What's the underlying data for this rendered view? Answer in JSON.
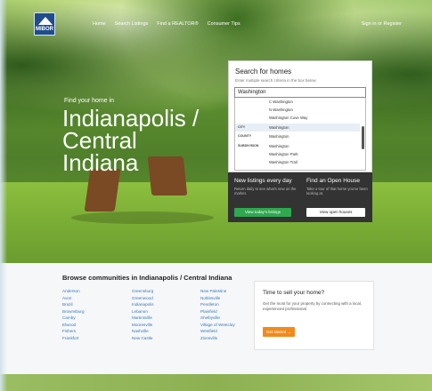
{
  "nav": {
    "logo_text": "MIBOR",
    "items": [
      "Home",
      "Search Listings",
      "Find a REALTOR®",
      "Consumer Tips"
    ],
    "signin": "Sign in or Register"
  },
  "hero": {
    "find_label": "Find your home in",
    "city_line1": "Indianapolis /",
    "city_line2": "Central",
    "city_line3": "Indiana"
  },
  "search": {
    "title": "Search for homes",
    "subtitle": "Enter multiple search criteria in the box below",
    "input_value": "Washington",
    "suggestions": [
      {
        "category": "",
        "value": "C Washington"
      },
      {
        "category": "",
        "value": "N Washington"
      },
      {
        "category": "",
        "value": "Washington Cove Way"
      },
      {
        "category": "CITY",
        "value": "Washington"
      },
      {
        "category": "COUNTY",
        "value": "Washington"
      },
      {
        "category": "SUBDIVISION",
        "value": "Washington"
      },
      {
        "category": "",
        "value": "Washington Park"
      },
      {
        "category": "",
        "value": "Washington Trail"
      }
    ]
  },
  "promo": {
    "left_title": "New listings every day",
    "left_desc": "Return daily to see what's new on the market.",
    "left_button": "View today's listings",
    "right_title": "Find an Open House",
    "right_desc": "Take a tour of that home you've been looking at.",
    "right_button": "View open houses"
  },
  "browse": {
    "title": "Browse communities in Indianapolis / Central Indiana",
    "col1": [
      "Anderson",
      "Avon",
      "Brazil",
      "Brownsburg",
      "Camby",
      "Elwood",
      "Fishers",
      "Frankfort"
    ],
    "col2": [
      "Greensburg",
      "Greenwood",
      "Indianapolis",
      "Lebanon",
      "Martinsville",
      "Mooresville",
      "Nashville",
      "New Castle"
    ],
    "col3": [
      "New Palestine",
      "Noblesville",
      "Pendleton",
      "Plainfield",
      "Shelbyville",
      "Village of Westclay",
      "Westfield",
      "Zionsville"
    ]
  },
  "sell": {
    "title": "Time to sell your home?",
    "desc": "Get the most for your property by connecting with a local, experienced professional.",
    "button": "Get started →"
  }
}
